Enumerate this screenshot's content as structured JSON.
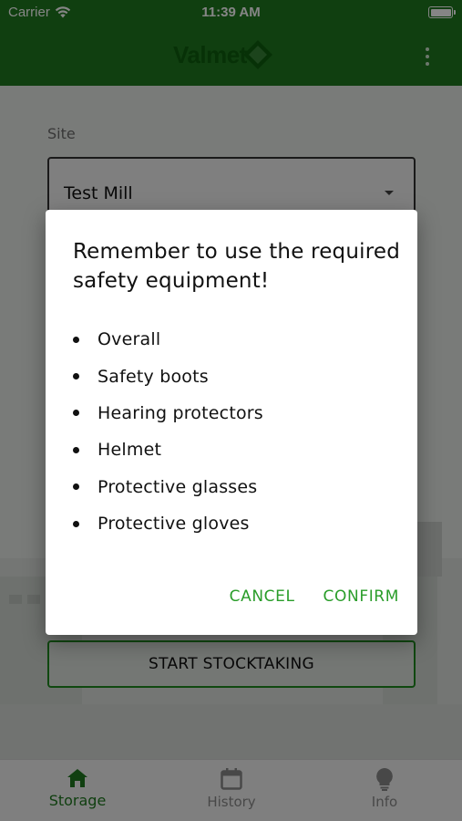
{
  "status_bar": {
    "carrier": "Carrier",
    "time": "11:39 AM"
  },
  "app_bar": {
    "logo_text": "Valmet",
    "more_icon": "more-vertical-icon"
  },
  "form": {
    "site_label": "Site",
    "site_value": "Test Mill",
    "start_button_label": "START STOCKTAKING"
  },
  "dialog": {
    "title": "Remember to use the required safety equipment!",
    "items": [
      "Overall",
      "Safety boots",
      "Hearing protectors",
      "Helmet",
      "Protective glasses",
      "Protective gloves"
    ],
    "cancel_label": "CANCEL",
    "confirm_label": "CONFIRM"
  },
  "bottom_nav": {
    "items": [
      {
        "label": "Storage",
        "icon": "home-icon",
        "active": true
      },
      {
        "label": "History",
        "icon": "calendar-icon",
        "active": false
      },
      {
        "label": "Info",
        "icon": "lightbulb-icon",
        "active": false
      }
    ]
  },
  "colors": {
    "brand_green": "#1f7a1f",
    "accent_green": "#2a9d2a",
    "scrim": "rgba(0,0,0,0.48)"
  }
}
